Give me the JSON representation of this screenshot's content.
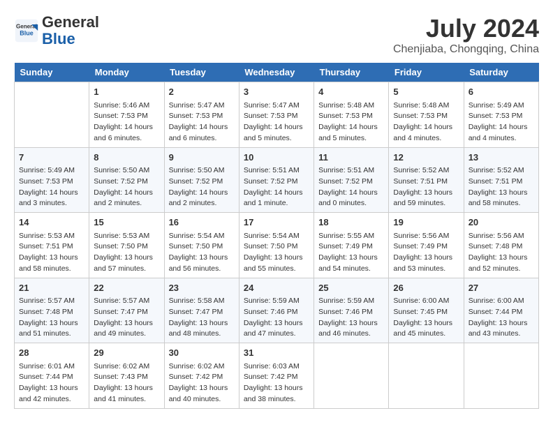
{
  "header": {
    "logo_line1": "General",
    "logo_line2": "Blue",
    "month_year": "July 2024",
    "location": "Chenjiaba, Chongqing, China"
  },
  "weekdays": [
    "Sunday",
    "Monday",
    "Tuesday",
    "Wednesday",
    "Thursday",
    "Friday",
    "Saturday"
  ],
  "weeks": [
    [
      {
        "day": "",
        "info": ""
      },
      {
        "day": "1",
        "info": "Sunrise: 5:46 AM\nSunset: 7:53 PM\nDaylight: 14 hours\nand 6 minutes."
      },
      {
        "day": "2",
        "info": "Sunrise: 5:47 AM\nSunset: 7:53 PM\nDaylight: 14 hours\nand 6 minutes."
      },
      {
        "day": "3",
        "info": "Sunrise: 5:47 AM\nSunset: 7:53 PM\nDaylight: 14 hours\nand 5 minutes."
      },
      {
        "day": "4",
        "info": "Sunrise: 5:48 AM\nSunset: 7:53 PM\nDaylight: 14 hours\nand 5 minutes."
      },
      {
        "day": "5",
        "info": "Sunrise: 5:48 AM\nSunset: 7:53 PM\nDaylight: 14 hours\nand 4 minutes."
      },
      {
        "day": "6",
        "info": "Sunrise: 5:49 AM\nSunset: 7:53 PM\nDaylight: 14 hours\nand 4 minutes."
      }
    ],
    [
      {
        "day": "7",
        "info": "Sunrise: 5:49 AM\nSunset: 7:53 PM\nDaylight: 14 hours\nand 3 minutes."
      },
      {
        "day": "8",
        "info": "Sunrise: 5:50 AM\nSunset: 7:52 PM\nDaylight: 14 hours\nand 2 minutes."
      },
      {
        "day": "9",
        "info": "Sunrise: 5:50 AM\nSunset: 7:52 PM\nDaylight: 14 hours\nand 2 minutes."
      },
      {
        "day": "10",
        "info": "Sunrise: 5:51 AM\nSunset: 7:52 PM\nDaylight: 14 hours\nand 1 minute."
      },
      {
        "day": "11",
        "info": "Sunrise: 5:51 AM\nSunset: 7:52 PM\nDaylight: 14 hours\nand 0 minutes."
      },
      {
        "day": "12",
        "info": "Sunrise: 5:52 AM\nSunset: 7:51 PM\nDaylight: 13 hours\nand 59 minutes."
      },
      {
        "day": "13",
        "info": "Sunrise: 5:52 AM\nSunset: 7:51 PM\nDaylight: 13 hours\nand 58 minutes."
      }
    ],
    [
      {
        "day": "14",
        "info": "Sunrise: 5:53 AM\nSunset: 7:51 PM\nDaylight: 13 hours\nand 58 minutes."
      },
      {
        "day": "15",
        "info": "Sunrise: 5:53 AM\nSunset: 7:50 PM\nDaylight: 13 hours\nand 57 minutes."
      },
      {
        "day": "16",
        "info": "Sunrise: 5:54 AM\nSunset: 7:50 PM\nDaylight: 13 hours\nand 56 minutes."
      },
      {
        "day": "17",
        "info": "Sunrise: 5:54 AM\nSunset: 7:50 PM\nDaylight: 13 hours\nand 55 minutes."
      },
      {
        "day": "18",
        "info": "Sunrise: 5:55 AM\nSunset: 7:49 PM\nDaylight: 13 hours\nand 54 minutes."
      },
      {
        "day": "19",
        "info": "Sunrise: 5:56 AM\nSunset: 7:49 PM\nDaylight: 13 hours\nand 53 minutes."
      },
      {
        "day": "20",
        "info": "Sunrise: 5:56 AM\nSunset: 7:48 PM\nDaylight: 13 hours\nand 52 minutes."
      }
    ],
    [
      {
        "day": "21",
        "info": "Sunrise: 5:57 AM\nSunset: 7:48 PM\nDaylight: 13 hours\nand 51 minutes."
      },
      {
        "day": "22",
        "info": "Sunrise: 5:57 AM\nSunset: 7:47 PM\nDaylight: 13 hours\nand 49 minutes."
      },
      {
        "day": "23",
        "info": "Sunrise: 5:58 AM\nSunset: 7:47 PM\nDaylight: 13 hours\nand 48 minutes."
      },
      {
        "day": "24",
        "info": "Sunrise: 5:59 AM\nSunset: 7:46 PM\nDaylight: 13 hours\nand 47 minutes."
      },
      {
        "day": "25",
        "info": "Sunrise: 5:59 AM\nSunset: 7:46 PM\nDaylight: 13 hours\nand 46 minutes."
      },
      {
        "day": "26",
        "info": "Sunrise: 6:00 AM\nSunset: 7:45 PM\nDaylight: 13 hours\nand 45 minutes."
      },
      {
        "day": "27",
        "info": "Sunrise: 6:00 AM\nSunset: 7:44 PM\nDaylight: 13 hours\nand 43 minutes."
      }
    ],
    [
      {
        "day": "28",
        "info": "Sunrise: 6:01 AM\nSunset: 7:44 PM\nDaylight: 13 hours\nand 42 minutes."
      },
      {
        "day": "29",
        "info": "Sunrise: 6:02 AM\nSunset: 7:43 PM\nDaylight: 13 hours\nand 41 minutes."
      },
      {
        "day": "30",
        "info": "Sunrise: 6:02 AM\nSunset: 7:42 PM\nDaylight: 13 hours\nand 40 minutes."
      },
      {
        "day": "31",
        "info": "Sunrise: 6:03 AM\nSunset: 7:42 PM\nDaylight: 13 hours\nand 38 minutes."
      },
      {
        "day": "",
        "info": ""
      },
      {
        "day": "",
        "info": ""
      },
      {
        "day": "",
        "info": ""
      }
    ]
  ]
}
